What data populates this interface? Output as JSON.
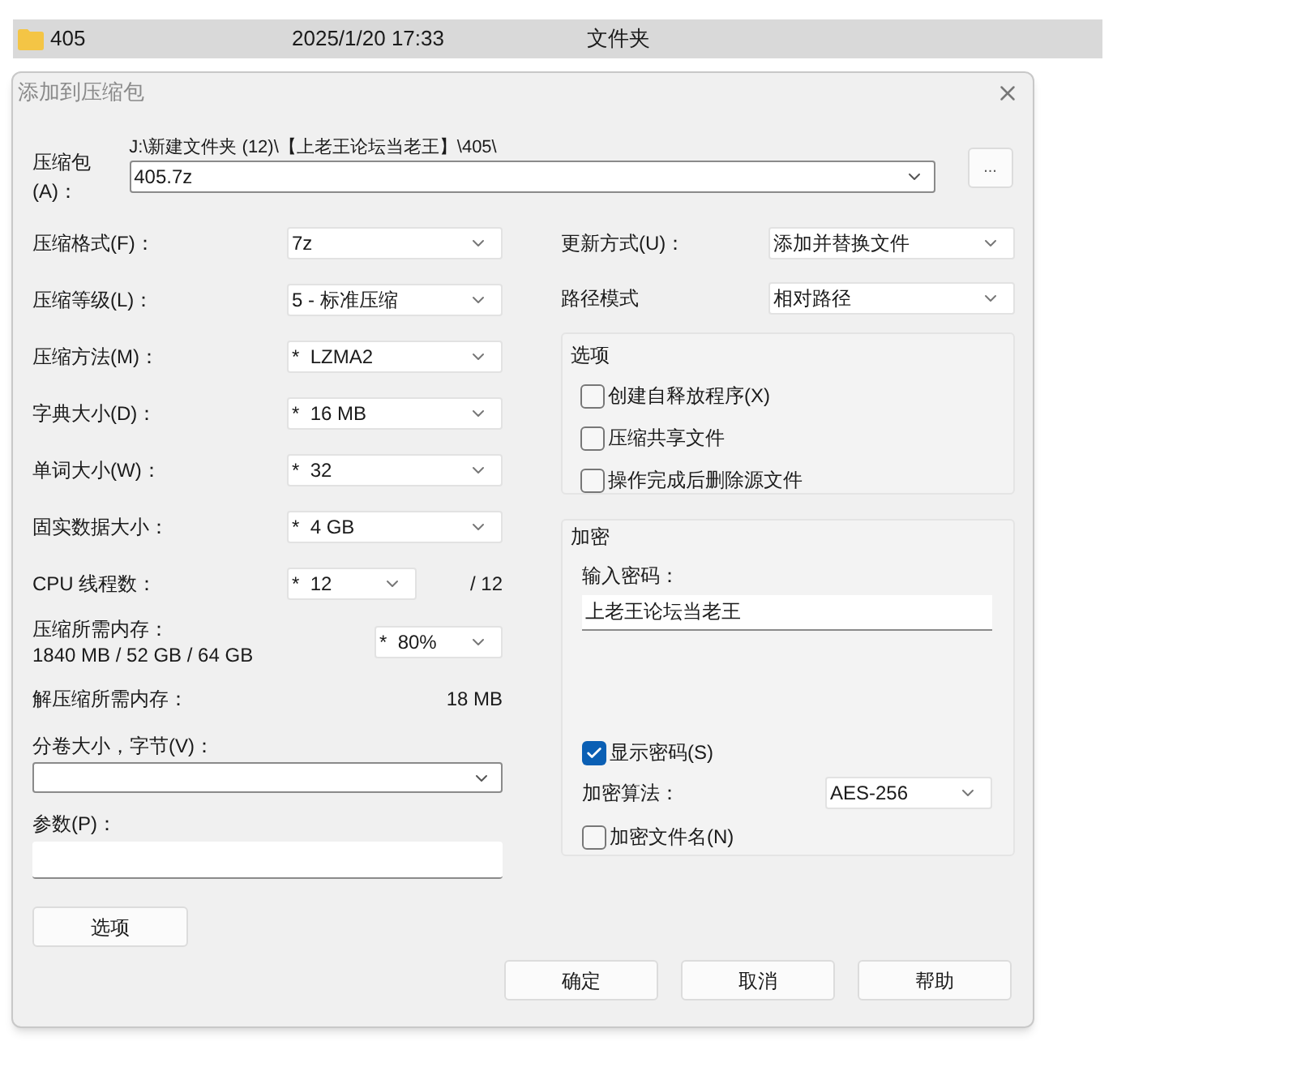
{
  "file_row": {
    "name": "405",
    "date": "2025/1/20 17:33",
    "type": "文件夹"
  },
  "dialog": {
    "title": "添加到压缩包"
  },
  "archive": {
    "label": "压缩包(A)：",
    "path": "J:\\新建文件夹 (12)\\【上老王论坛当老王】\\405\\",
    "value": "405.7z",
    "browse": "..."
  },
  "left_settings": [
    {
      "label": "压缩格式(F)：",
      "value": "7z"
    },
    {
      "label": "压缩等级(L)：",
      "value": "5 - 标准压缩"
    },
    {
      "label": "压缩方法(M)：",
      "value": "*  LZMA2"
    },
    {
      "label": "字典大小(D)：",
      "value": "*  16 MB"
    },
    {
      "label": "单词大小(W)：",
      "value": "*  32"
    },
    {
      "label": "固实数据大小：",
      "value": "*  4 GB"
    }
  ],
  "cpu": {
    "label": "CPU 线程数：",
    "value": "*  12",
    "total": "/ 12"
  },
  "memory": {
    "label": "压缩所需内存：",
    "detail": "1840 MB / 52 GB / 64 GB",
    "value": "*  80%"
  },
  "decompress": {
    "label": "解压缩所需内存：",
    "value": "18 MB"
  },
  "volume": {
    "label": "分卷大小，字节(V)："
  },
  "params": {
    "label": "参数(P)："
  },
  "options_button": "选项",
  "right_settings": [
    {
      "label": "更新方式(U)：",
      "value": "添加并替换文件"
    },
    {
      "label": "路径模式",
      "value": "相对路径"
    }
  ],
  "options_group": {
    "title": "选项",
    "items": [
      {
        "label": "创建自释放程序(X)",
        "checked": false
      },
      {
        "label": "压缩共享文件",
        "checked": false
      },
      {
        "label": "操作完成后删除源文件",
        "checked": false
      }
    ]
  },
  "encryption": {
    "title": "加密",
    "password_label": "输入密码：",
    "password": "上老王论坛当老王",
    "show_password": {
      "label": "显示密码(S)",
      "checked": true
    },
    "method_label": "加密算法：",
    "method": "AES-256",
    "encrypt_names": {
      "label": "加密文件名(N)",
      "checked": false
    }
  },
  "buttons": [
    "确定",
    "取消",
    "帮助"
  ]
}
